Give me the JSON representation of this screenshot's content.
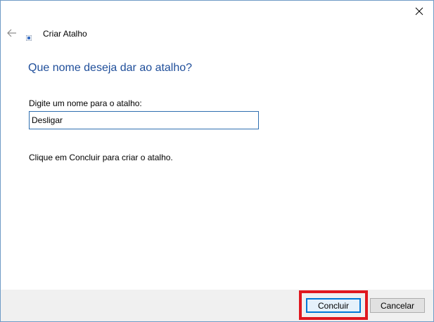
{
  "window": {
    "title": "Criar Atalho"
  },
  "main": {
    "heading": "Que nome deseja dar ao atalho?",
    "field_label": "Digite um nome para o atalho:",
    "name_value": "Desligar",
    "instruction": "Clique em Concluir para criar o atalho."
  },
  "footer": {
    "finish_label": "Concluir",
    "cancel_label": "Cancelar"
  },
  "icons": {
    "close": "close-icon",
    "back": "back-arrow-icon",
    "title": "shortcut-icon"
  },
  "colors": {
    "heading": "#1f4e9a",
    "input_border": "#2f6fb0",
    "highlight": "#e0181f",
    "primary_button_border": "#0078d7"
  }
}
